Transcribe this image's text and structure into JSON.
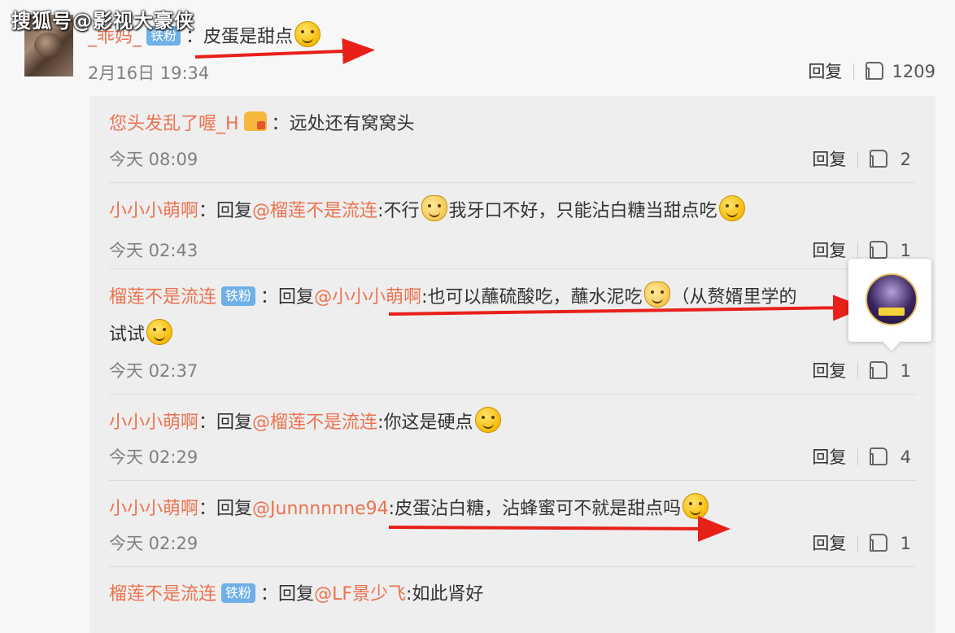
{
  "watermark": "搜狐号@影视大豪侠",
  "main_comment": {
    "author": "_乖妈_",
    "badge": "铁粉",
    "sep": "：",
    "text": "皮蛋是甜点",
    "time": "2月16日 19:34",
    "reply_label": "回复",
    "likes": "1209"
  },
  "replies": [
    {
      "author": "您头发乱了喔_H",
      "badge": "",
      "sep": "：",
      "reply_prefix": "",
      "target": "",
      "colon": "",
      "text": "远处还有窝窝头",
      "text2": "",
      "time": "今天 08:09",
      "reply_label": "回复",
      "likes": "2"
    },
    {
      "author": "小小小萌啊",
      "badge": "",
      "sep": "：",
      "reply_prefix": "回复",
      "target": "@榴莲不是流连",
      "colon": ":",
      "text": "不行",
      "text_b": "我牙口不好，只能沾白糖当甜点吃",
      "time": "今天 02:43",
      "reply_label": "回复",
      "likes": "1"
    },
    {
      "author": "榴莲不是流连",
      "badge": "铁粉",
      "sep": "：",
      "reply_prefix": "回复",
      "target": "@小小小萌啊",
      "colon": ":",
      "text": "也可以蘸硫酸吃，蘸水泥吃",
      "text_b": "（从赘婿里学的",
      "text2": "试试",
      "time": "今天 02:37",
      "reply_label": "回复",
      "likes": "1"
    },
    {
      "author": "小小小萌啊",
      "badge": "",
      "sep": "：",
      "reply_prefix": "回复",
      "target": "@榴莲不是流连",
      "colon": ":",
      "text": "你这是硬点",
      "time": "今天 02:29",
      "reply_label": "回复",
      "likes": "4"
    },
    {
      "author": "小小小萌啊",
      "badge": "",
      "sep": "：",
      "reply_prefix": "回复",
      "target": "@Junnnnnne94",
      "colon": ":",
      "text": "皮蛋沾白糖，沾蜂蜜可不就是甜点吗",
      "time": "今天 02:29",
      "reply_label": "回复",
      "likes": "1"
    },
    {
      "author": "榴莲不是流连",
      "badge": "铁粉",
      "sep": "：",
      "reply_prefix": "回复",
      "target": "@LF景少飞",
      "colon": ":",
      "text": "如此肾好",
      "time": "",
      "reply_label": "",
      "likes": ""
    }
  ],
  "colors": {
    "name": "#eb7350",
    "arrow": "#e8201a",
    "badge": "#6fb0e8"
  },
  "icons": [
    "thumb-up-icon",
    "laugh-cry-emoji",
    "cat-emoji",
    "grin-emoji",
    "vip-crown-icon",
    "avatar-popup"
  ]
}
